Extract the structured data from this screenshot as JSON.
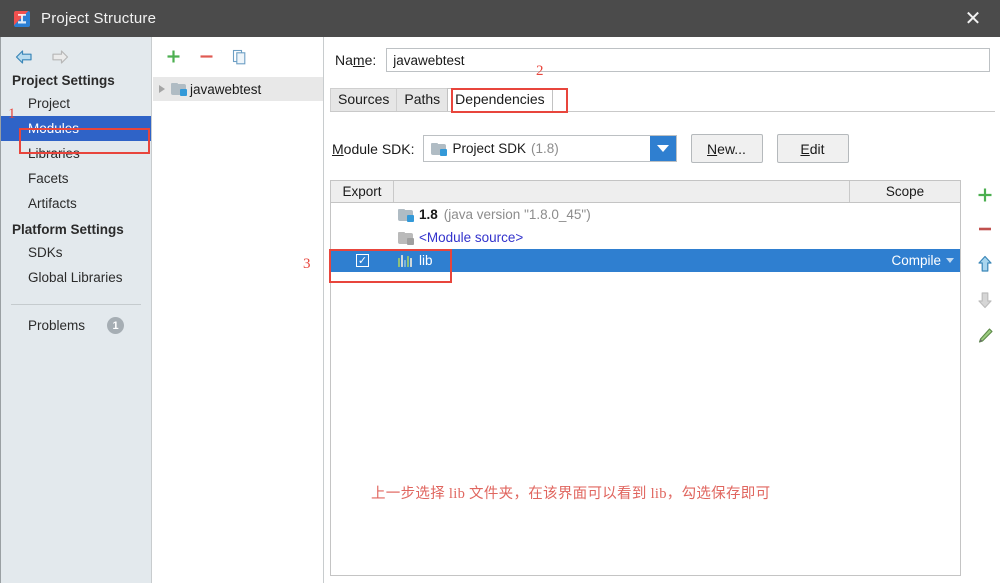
{
  "window": {
    "title": "Project Structure",
    "icon": "intellij-idea-icon",
    "close_label": "✕"
  },
  "sidebar": {
    "nav": {
      "back_icon": "back-arrow-icon",
      "forward_icon": "forward-arrow-icon"
    },
    "groups": [
      {
        "label": "Project Settings",
        "items": [
          {
            "label": "Project",
            "selected": false
          },
          {
            "label": "Modules",
            "selected": true
          },
          {
            "label": "Libraries",
            "selected": false
          },
          {
            "label": "Facets",
            "selected": false
          },
          {
            "label": "Artifacts",
            "selected": false
          }
        ]
      },
      {
        "label": "Platform Settings",
        "items": [
          {
            "label": "SDKs",
            "selected": false
          },
          {
            "label": "Global Libraries",
            "selected": false
          }
        ]
      }
    ],
    "problems": {
      "label": "Problems",
      "count": "1"
    }
  },
  "modules_panel": {
    "toolbar": [
      {
        "name": "add-module-button",
        "glyph": "+"
      },
      {
        "name": "remove-module-button",
        "glyph": "−"
      },
      {
        "name": "copy-module-button",
        "glyph": "copy-icon"
      }
    ],
    "tree": [
      {
        "label": "javawebtest",
        "icon": "module-folder-icon",
        "expanded": false,
        "selected": true
      }
    ]
  },
  "editor": {
    "name_field": {
      "label": "Name:",
      "value": "javawebtest",
      "placeholder": ""
    },
    "tabs": [
      {
        "label": "Sources",
        "active": false
      },
      {
        "label": "Paths",
        "active": false
      },
      {
        "label": "Dependencies",
        "active": true
      }
    ],
    "sdk": {
      "label": "Module SDK:",
      "selected": "Project SDK",
      "version": "(1.8)",
      "icon": "sdk-folder-icon",
      "new_button": "New...",
      "edit_button": "Edit"
    },
    "dependencies": {
      "columns": {
        "export": "Export",
        "name": "",
        "scope": "Scope"
      },
      "rows": [
        {
          "export_checked": null,
          "icon": "sdk-folder-icon",
          "name": "1.8",
          "detail": "(java version \"1.8.0_45\")",
          "scope": "",
          "selected": false,
          "style": "sdk"
        },
        {
          "export_checked": null,
          "icon": "module-source-icon",
          "name": "<Module source>",
          "detail": "",
          "scope": "",
          "selected": false,
          "style": "link"
        },
        {
          "export_checked": true,
          "icon": "library-jar-icon",
          "name": "lib",
          "detail": "",
          "scope": "Compile",
          "selected": true,
          "style": "plain"
        }
      ]
    },
    "side_toolbar": [
      {
        "name": "add-dependency-button",
        "glyph": "+",
        "enabled": true
      },
      {
        "name": "remove-dependency-button",
        "glyph": "−",
        "enabled": true
      },
      {
        "name": "move-up-button",
        "glyph": "up-arrow-icon",
        "enabled": true
      },
      {
        "name": "move-down-button",
        "glyph": "down-arrow-icon",
        "enabled": false
      },
      {
        "name": "edit-dependency-button",
        "glyph": "pencil-icon",
        "enabled": true
      }
    ]
  },
  "annotations": {
    "step1": "1",
    "step2": "2",
    "step3": "3",
    "note": "上一步选择 lib 文件夹，在该界面可以看到 lib，勾选保存即可",
    "highlight_color": "#e8453c"
  }
}
